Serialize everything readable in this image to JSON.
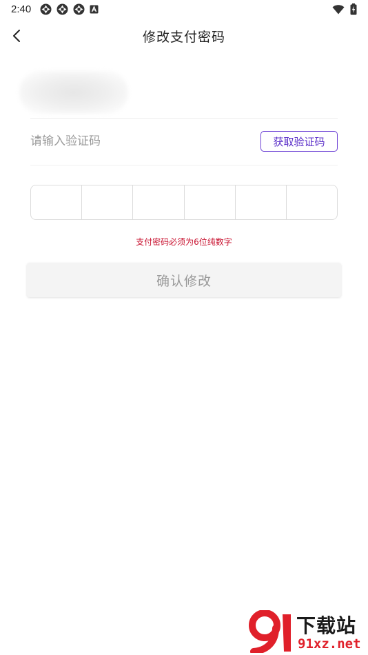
{
  "status_bar": {
    "time": "2:40",
    "left_icons": [
      "aperture-icon",
      "aperture-icon",
      "aperture-icon",
      "a-square-icon"
    ],
    "right_icons": [
      "wifi-icon",
      "battery-charging-icon"
    ]
  },
  "header": {
    "title": "修改支付密码",
    "back_icon": "chevron-left-icon"
  },
  "form": {
    "code_placeholder": "请输入验证码",
    "code_value": "",
    "get_code_label": "获取验证码",
    "pin_length": 6,
    "hint": "支付密码必须为6位纯数字",
    "confirm_label": "确认修改"
  },
  "watermark": {
    "title": "下载站",
    "url": "91xz.net"
  },
  "colors": {
    "accent": "#5b2fc9",
    "hint": "#c8102e",
    "button_disabled_bg": "#f4f4f4",
    "button_disabled_text": "#9a9a9a",
    "watermark_red": "#e0202a"
  }
}
